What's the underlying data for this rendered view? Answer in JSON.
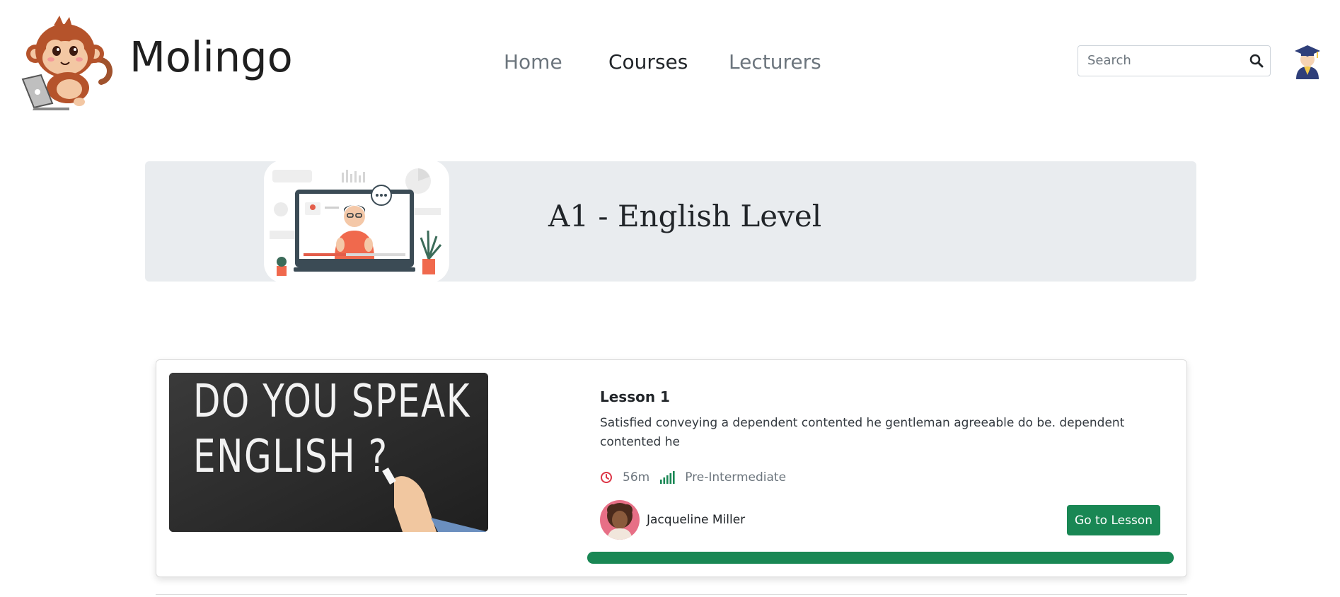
{
  "header": {
    "brand": "Molingo",
    "nav": [
      {
        "label": "Home",
        "active": false
      },
      {
        "label": "Courses",
        "active": true
      },
      {
        "label": "Lecturers",
        "active": false
      }
    ],
    "search": {
      "placeholder": "Search",
      "value": ""
    }
  },
  "hero": {
    "title": "A1 - English Level"
  },
  "lesson": {
    "image_text_line1": "DO YOU SPEAK",
    "image_text_line2": "ENGLISH ?",
    "title": "Lesson 1",
    "description": "Satisfied conveying a dependent contented he gentleman agreeable do be. dependent contented he",
    "duration": "56m",
    "level": "Pre-Intermediate",
    "author": "Jacqueline Miller",
    "button_label": "Go to Lesson",
    "progress_percent": 100
  },
  "colors": {
    "accent_green": "#198754",
    "clock_red": "#dc3545",
    "hero_bg": "#e9ecef"
  },
  "icons": {
    "search": "search-icon",
    "clock": "clock-icon",
    "level": "signal-bars-icon",
    "user": "graduate-avatar-icon"
  }
}
